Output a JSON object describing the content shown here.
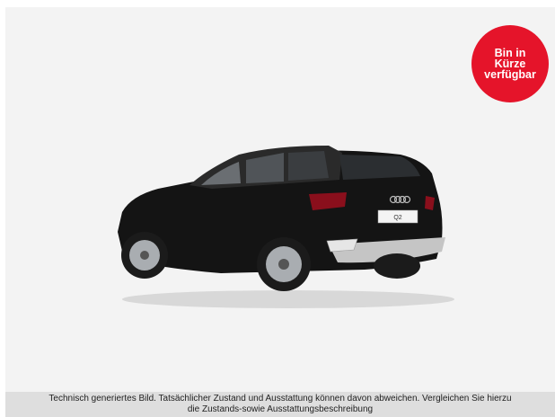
{
  "badge": {
    "line1": "Bin in",
    "line2": "Kürze",
    "line3": "verfügbar",
    "color": "#e5142a"
  },
  "car": {
    "plate_text": "Q2",
    "color": "#151515",
    "icon": "car-rear-view-icon"
  },
  "disclaimer": {
    "line1": "Technisch generiertes Bild. Tatsächlicher Zustand und Ausstattung können davon abweichen. Vergleichen Sie hierzu",
    "line2": "die Zustands-sowie Ausstattungsbeschreibung"
  }
}
